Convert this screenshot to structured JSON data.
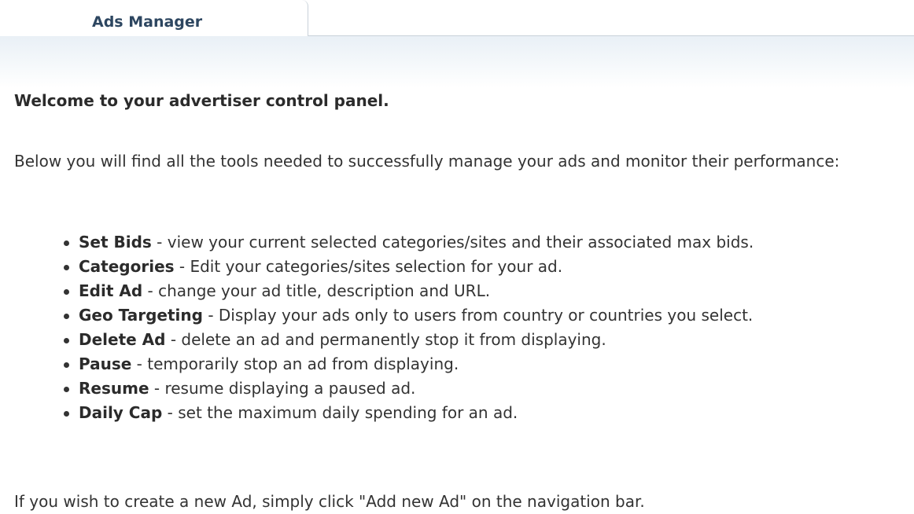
{
  "tab": {
    "label": "Ads Manager"
  },
  "welcome": "Welcome to your advertiser control panel.",
  "intro": "Below you will find all the tools needed to successfully manage your ads and monitor their performance:",
  "features": [
    {
      "term": "Set Bids",
      "desc": " - view your current selected categories/sites and their associated max bids."
    },
    {
      "term": "Categories",
      "desc": " - Edit your categories/sites selection for your ad."
    },
    {
      "term": "Edit Ad",
      "desc": " - change your ad title, description and URL."
    },
    {
      "term": "Geo Targeting",
      "desc": " - Display your ads only to users from country or countries you select."
    },
    {
      "term": "Delete Ad",
      "desc": " - delete an ad and permanently stop it from displaying."
    },
    {
      "term": "Pause",
      "desc": " - temporarily stop an ad from displaying."
    },
    {
      "term": "Resume",
      "desc": " - resume displaying a paused ad."
    },
    {
      "term": "Daily Cap",
      "desc": " - set the maximum daily spending for an ad."
    }
  ],
  "footer": "If you wish to create a new Ad, simply click \"Add new Ad\" on the navigation bar.",
  "colors": {
    "tab_text": "#2d4660",
    "body_text": "#333333",
    "band": "#e9f0f6"
  }
}
